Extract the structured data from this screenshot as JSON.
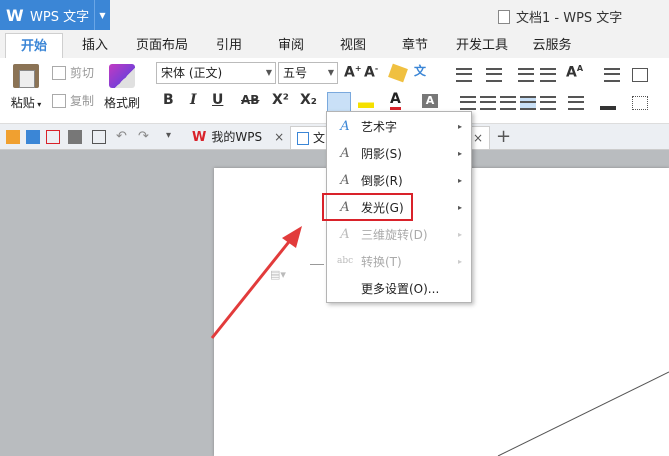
{
  "app": {
    "logo": "W",
    "name": "WPS 文字",
    "dropdown_icon": "chevron-down-icon"
  },
  "window": {
    "title": "文档1 - WPS 文字"
  },
  "ribbon_tabs": [
    "开始",
    "插入",
    "页面布局",
    "引用",
    "审阅",
    "视图",
    "章节",
    "开发工具",
    "云服务"
  ],
  "toolbar": {
    "paste": "粘贴",
    "cut": "剪切",
    "copy": "复制",
    "format_painter": "格式刷",
    "font_name": "宋体 (正文)",
    "font_size": "五号",
    "bold": "B",
    "italic": "I",
    "underline": "U",
    "strike": "AB",
    "superscript": "X²",
    "subscript": "X₂",
    "font_color": "A"
  },
  "doc_tabs": {
    "my_wps": "我的WPS",
    "doc": "文",
    "close": "×",
    "new": "+"
  },
  "menu": {
    "items": [
      {
        "icon": "A",
        "label": "艺术字",
        "arrow": "▸",
        "disabled": false
      },
      {
        "icon": "A",
        "label": "阴影(S)",
        "arrow": "▸",
        "disabled": false
      },
      {
        "icon": "A",
        "label": "倒影(R)",
        "arrow": "▸",
        "disabled": false
      },
      {
        "icon": "A",
        "label": "发光(G)",
        "arrow": "▸",
        "disabled": false
      },
      {
        "icon": "A",
        "label": "三维旋转(D)",
        "arrow": "▸",
        "disabled": true
      },
      {
        "icon": "abc",
        "label": "转换(T)",
        "arrow": "▸",
        "disabled": true
      },
      {
        "icon": "",
        "label": "更多设置(O)...",
        "arrow": "",
        "disabled": false
      }
    ]
  },
  "colors": {
    "accent": "#3b86d6",
    "highlight": "#d9222a",
    "arrow": "#e23b3b"
  }
}
